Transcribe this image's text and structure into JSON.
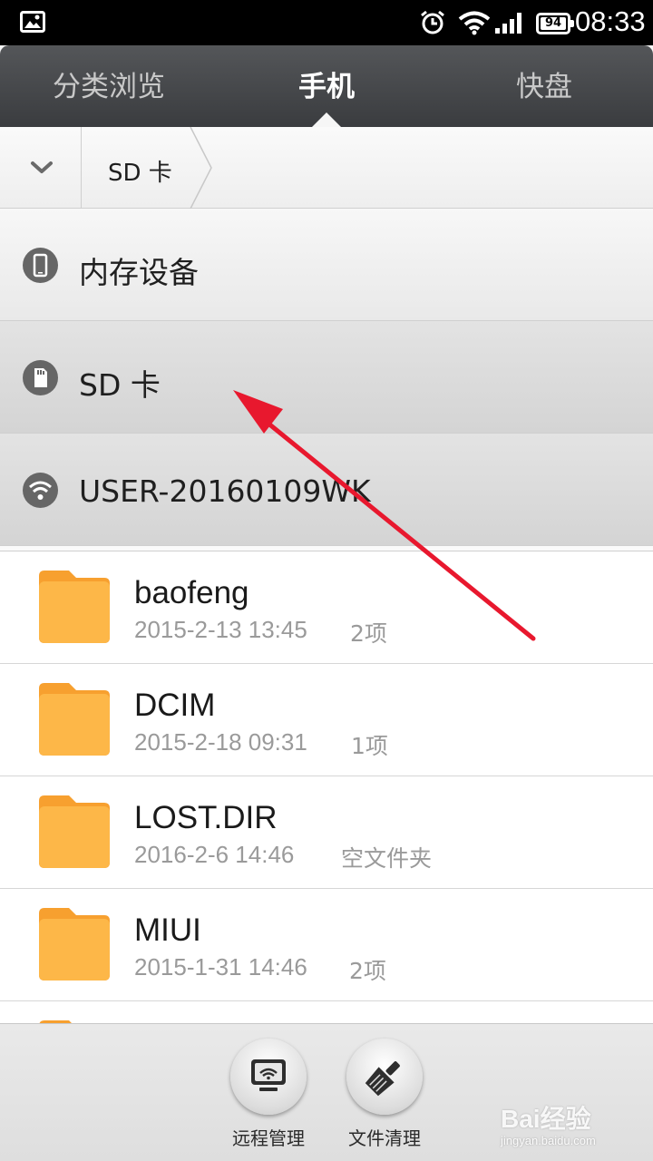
{
  "status_bar": {
    "battery": "94",
    "time": "08:33",
    "icons": [
      "gallery-icon",
      "alarm-icon",
      "wifi-icon",
      "signal-icon",
      "battery-icon"
    ]
  },
  "tabs": [
    {
      "label": "分类浏览",
      "active": false
    },
    {
      "label": "手机",
      "active": true
    },
    {
      "label": "快盘",
      "active": false
    }
  ],
  "breadcrumb": {
    "current": "SD 卡"
  },
  "storage": [
    {
      "label": "内存设备",
      "icon": "phone-icon"
    },
    {
      "label": "SD 卡",
      "icon": "sd-card-icon",
      "selected": true
    },
    {
      "label": "USER-20160109WK",
      "icon": "wifi-device-icon"
    }
  ],
  "folders": [
    {
      "name": "baofeng",
      "date": "2015-2-13 13:45",
      "count": "2项"
    },
    {
      "name": "DCIM",
      "date": "2015-2-18 09:31",
      "count": "1项"
    },
    {
      "name": "LOST.DIR",
      "date": "2016-2-6 14:46",
      "count": "空文件夹"
    },
    {
      "name": "MIUI",
      "date": "2015-1-31 14:46",
      "count": "2项"
    }
  ],
  "actions": {
    "remote_label": "远程管理",
    "clean_label": "文件清理"
  },
  "watermark": {
    "logo": "Bai经验",
    "sub": "jingyan.baidu.com"
  },
  "colors": {
    "folder": "#fbb040",
    "annotation": "#e8182e",
    "tabbar": "#45474a"
  }
}
